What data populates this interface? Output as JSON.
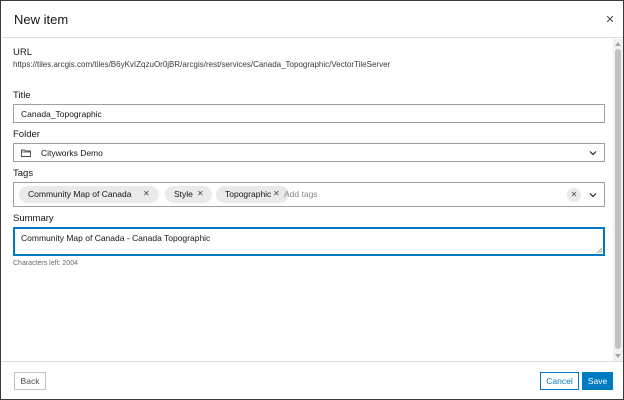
{
  "dialog": {
    "title": "New item",
    "close_icon": "close-icon"
  },
  "form": {
    "url": {
      "label": "URL",
      "value": "https://tiles.arcgis.com/tiles/B6yKvIZqzuOr0jBR/arcgis/rest/services/Canada_Topographic/VectorTileServer"
    },
    "title": {
      "label": "Title",
      "value": "Canada_Topographic"
    },
    "folder": {
      "label": "Folder",
      "value": "Cityworks Demo",
      "icon": "folder-icon"
    },
    "tags": {
      "label": "Tags",
      "items": [
        "Community Map of Canada",
        "Style",
        "Topographic"
      ],
      "placeholder": "Add tags"
    },
    "summary": {
      "label": "Summary",
      "value": "Community Map of Canada - Canada Topographic",
      "chars_left": "Characters left: 2004"
    }
  },
  "footer": {
    "back_label": "Back",
    "cancel_label": "Cancel",
    "save_label": "Save"
  },
  "colors": {
    "accent": "#007ac2",
    "border": "#9f9f9f",
    "chip": "#eaeaea"
  }
}
